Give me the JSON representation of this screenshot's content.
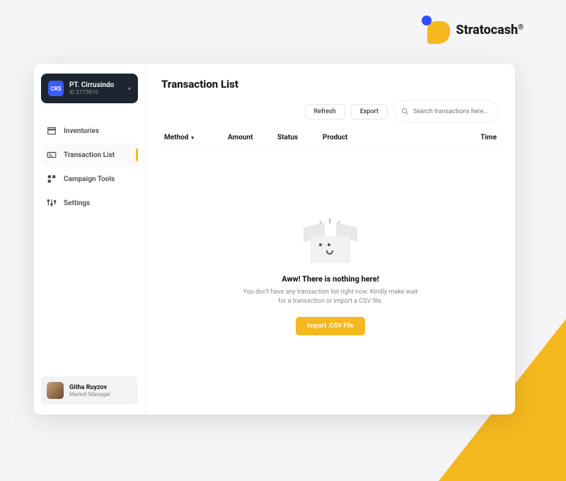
{
  "brand": {
    "name": "Stratocash",
    "reg": "®"
  },
  "account": {
    "badge": "CR$",
    "name": "PT. Cirrusindo",
    "id": "ID 2773810"
  },
  "nav": {
    "items": [
      {
        "label": "Inventories",
        "icon": "inventories-icon"
      },
      {
        "label": "Transaction List",
        "icon": "transaction-icon"
      },
      {
        "label": "Campaign Tools",
        "icon": "campaign-icon"
      },
      {
        "label": "Settings",
        "icon": "settings-icon"
      }
    ],
    "active_index": 1
  },
  "user": {
    "name": "Githa Ruyzov",
    "role": "Market Manager"
  },
  "page": {
    "title": "Transaction List"
  },
  "toolbar": {
    "refresh_label": "Refresh",
    "export_label": "Export",
    "search_placeholder": "Search transactions here..."
  },
  "table": {
    "columns": {
      "method": "Method",
      "amount": "Amount",
      "status": "Status",
      "product": "Product",
      "time": "Time"
    }
  },
  "empty": {
    "title": "Aww! There is nothing here!",
    "desc": "You don't have any transaction list right now. Kindly make wait for a transaction or import a CSV file.",
    "cta_label": "Import .CSV File"
  },
  "colors": {
    "accent": "#f5b81f",
    "brand_blue": "#2e4eff",
    "dark": "#1e2530"
  }
}
